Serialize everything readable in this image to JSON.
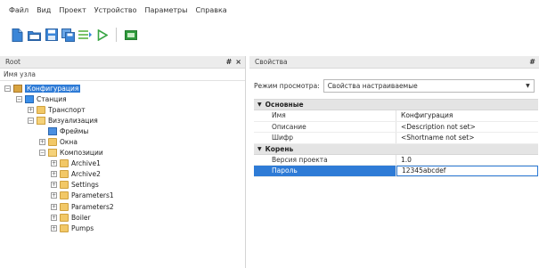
{
  "menu": [
    "Файл",
    "Вид",
    "Проект",
    "Устройство",
    "Параметры",
    "Справка"
  ],
  "toolbar": {
    "icons": [
      "new-file-icon",
      "open-folder-icon",
      "save-icon",
      "save-all-icon",
      "list-icon",
      "run-icon",
      "monitor-icon"
    ]
  },
  "tree_panel": {
    "title": "Root",
    "pin": "#",
    "close": "×",
    "column_header": "Имя узла",
    "nodes": [
      {
        "label": "Конфигурация",
        "indent": 0,
        "expander": "−",
        "icon": "config",
        "selected": true
      },
      {
        "label": "Станция",
        "indent": 1,
        "expander": "−",
        "icon": "station"
      },
      {
        "label": "Транспорт",
        "indent": 2,
        "expander": "+",
        "icon": "folder"
      },
      {
        "label": "Визуализация",
        "indent": 2,
        "expander": "−",
        "icon": "folder-open"
      },
      {
        "label": "Фреймы",
        "indent": 3,
        "expander": "",
        "icon": "frames"
      },
      {
        "label": "Окна",
        "indent": 3,
        "expander": "+",
        "icon": "folder"
      },
      {
        "label": "Композиции",
        "indent": 3,
        "expander": "−",
        "icon": "folder-open"
      },
      {
        "label": "Archive1",
        "indent": 4,
        "expander": "+",
        "icon": "folder"
      },
      {
        "label": "Archive2",
        "indent": 4,
        "expander": "+",
        "icon": "folder"
      },
      {
        "label": "Settings",
        "indent": 4,
        "expander": "+",
        "icon": "folder"
      },
      {
        "label": "Parameters1",
        "indent": 4,
        "expander": "+",
        "icon": "folder"
      },
      {
        "label": "Parameters2",
        "indent": 4,
        "expander": "+",
        "icon": "folder"
      },
      {
        "label": "Boiler",
        "indent": 4,
        "expander": "+",
        "icon": "folder"
      },
      {
        "label": "Pumps",
        "indent": 4,
        "expander": "+",
        "icon": "folder"
      }
    ]
  },
  "props_panel": {
    "title": "Свойства",
    "pin": "#",
    "close": "×",
    "view_label": "Режим просмотра:",
    "view_value": "Свойства настраиваемые",
    "categories": [
      {
        "name": "Основные",
        "rows": [
          {
            "name": "Имя",
            "value": "Конфигурация"
          },
          {
            "name": "Описание",
            "value": "<Description not set>"
          },
          {
            "name": "Шифр",
            "value": "<Shortname not set>"
          }
        ]
      },
      {
        "name": "Корень",
        "rows": [
          {
            "name": "Версия проекта",
            "value": "1.0"
          },
          {
            "name": "Пароль",
            "value": "12345abcdef",
            "selected": true
          }
        ]
      }
    ]
  }
}
